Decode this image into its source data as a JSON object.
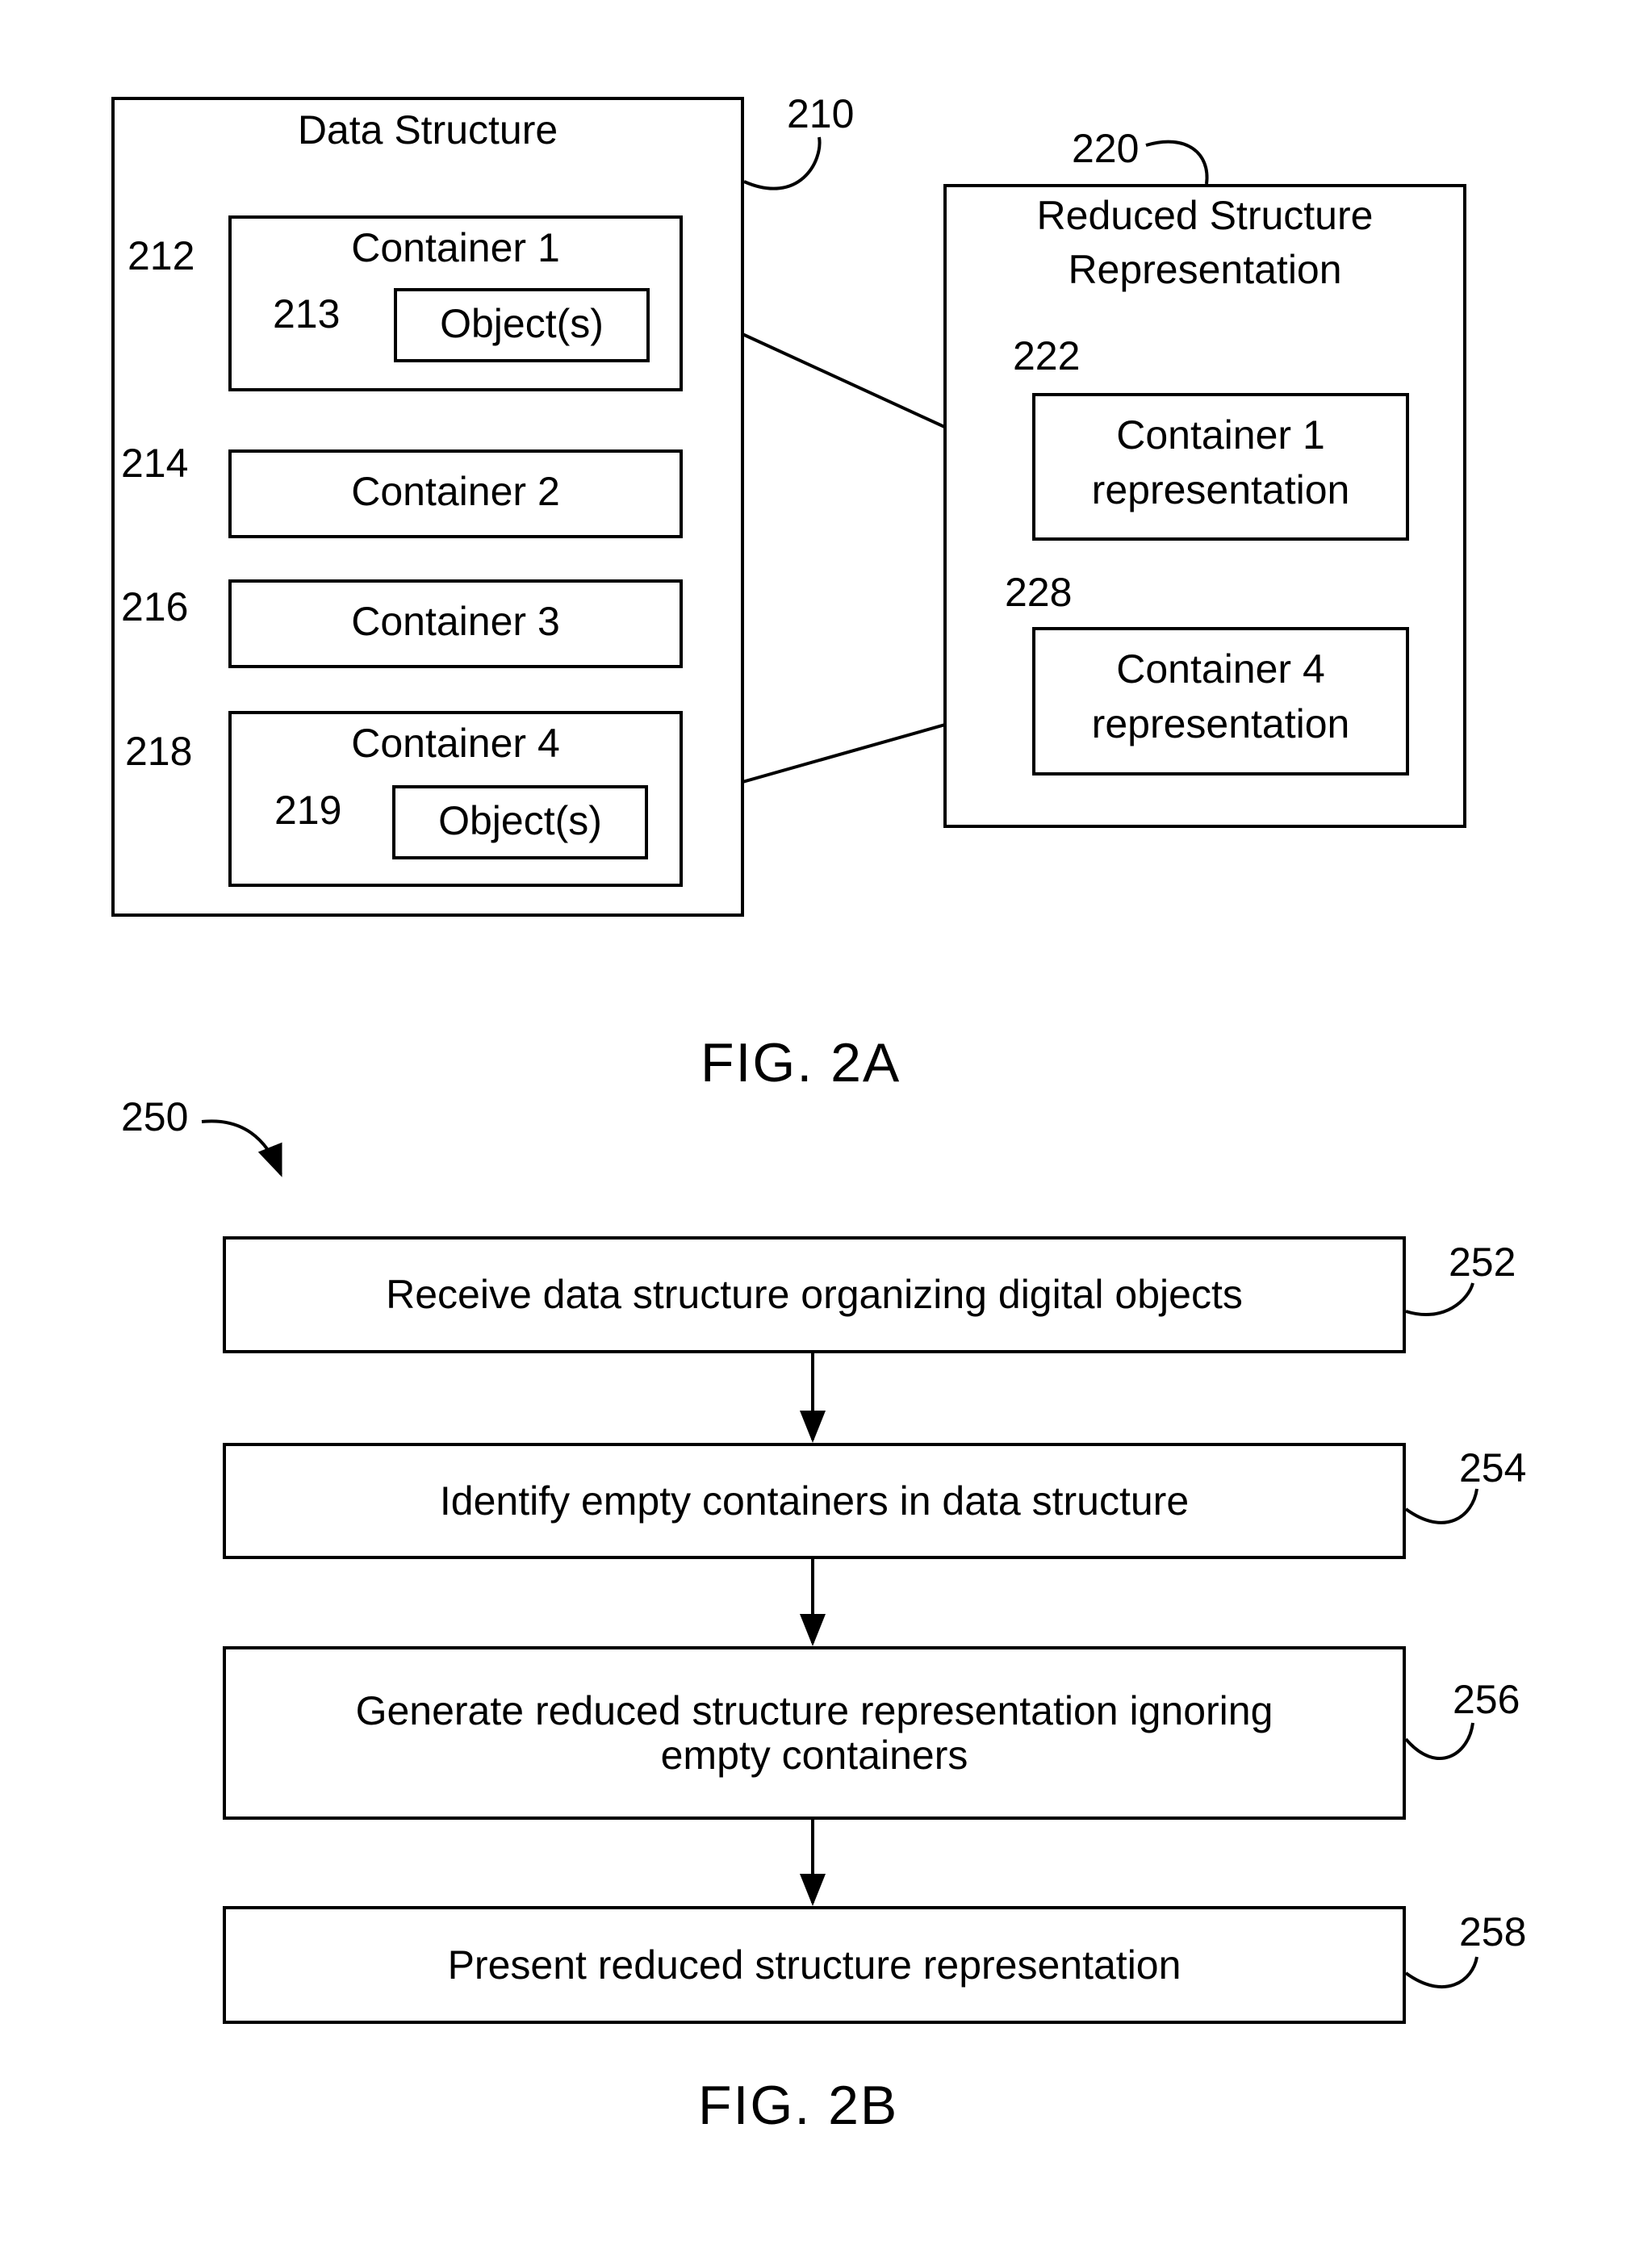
{
  "fig2a": {
    "caption": "FIG. 2A",
    "data_structure": {
      "ref": "210",
      "title": "Data Structure",
      "containers": [
        {
          "ref": "212",
          "label": "Container 1",
          "object_ref": "213",
          "object_label": "Object(s)"
        },
        {
          "ref": "214",
          "label": "Container 2"
        },
        {
          "ref": "216",
          "label": "Container 3"
        },
        {
          "ref": "218",
          "label": "Container 4",
          "object_ref": "219",
          "object_label": "Object(s)"
        }
      ]
    },
    "reduced": {
      "ref": "220",
      "title_line1": "Reduced Structure",
      "title_line2": "Representation",
      "items": [
        {
          "ref": "222",
          "line1": "Container 1",
          "line2": "representation"
        },
        {
          "ref": "228",
          "line1": "Container 4",
          "line2": "representation"
        }
      ]
    }
  },
  "fig2b": {
    "caption": "FIG. 2B",
    "ref": "250",
    "steps": [
      {
        "ref": "252",
        "line1": "Receive data structure organizing digital objects",
        "line2": ""
      },
      {
        "ref": "254",
        "line1": "Identify empty containers in data structure",
        "line2": ""
      },
      {
        "ref": "256",
        "line1": "Generate reduced structure representation ignoring",
        "line2": "empty containers"
      },
      {
        "ref": "258",
        "line1": "Present reduced structure representation",
        "line2": ""
      }
    ]
  }
}
